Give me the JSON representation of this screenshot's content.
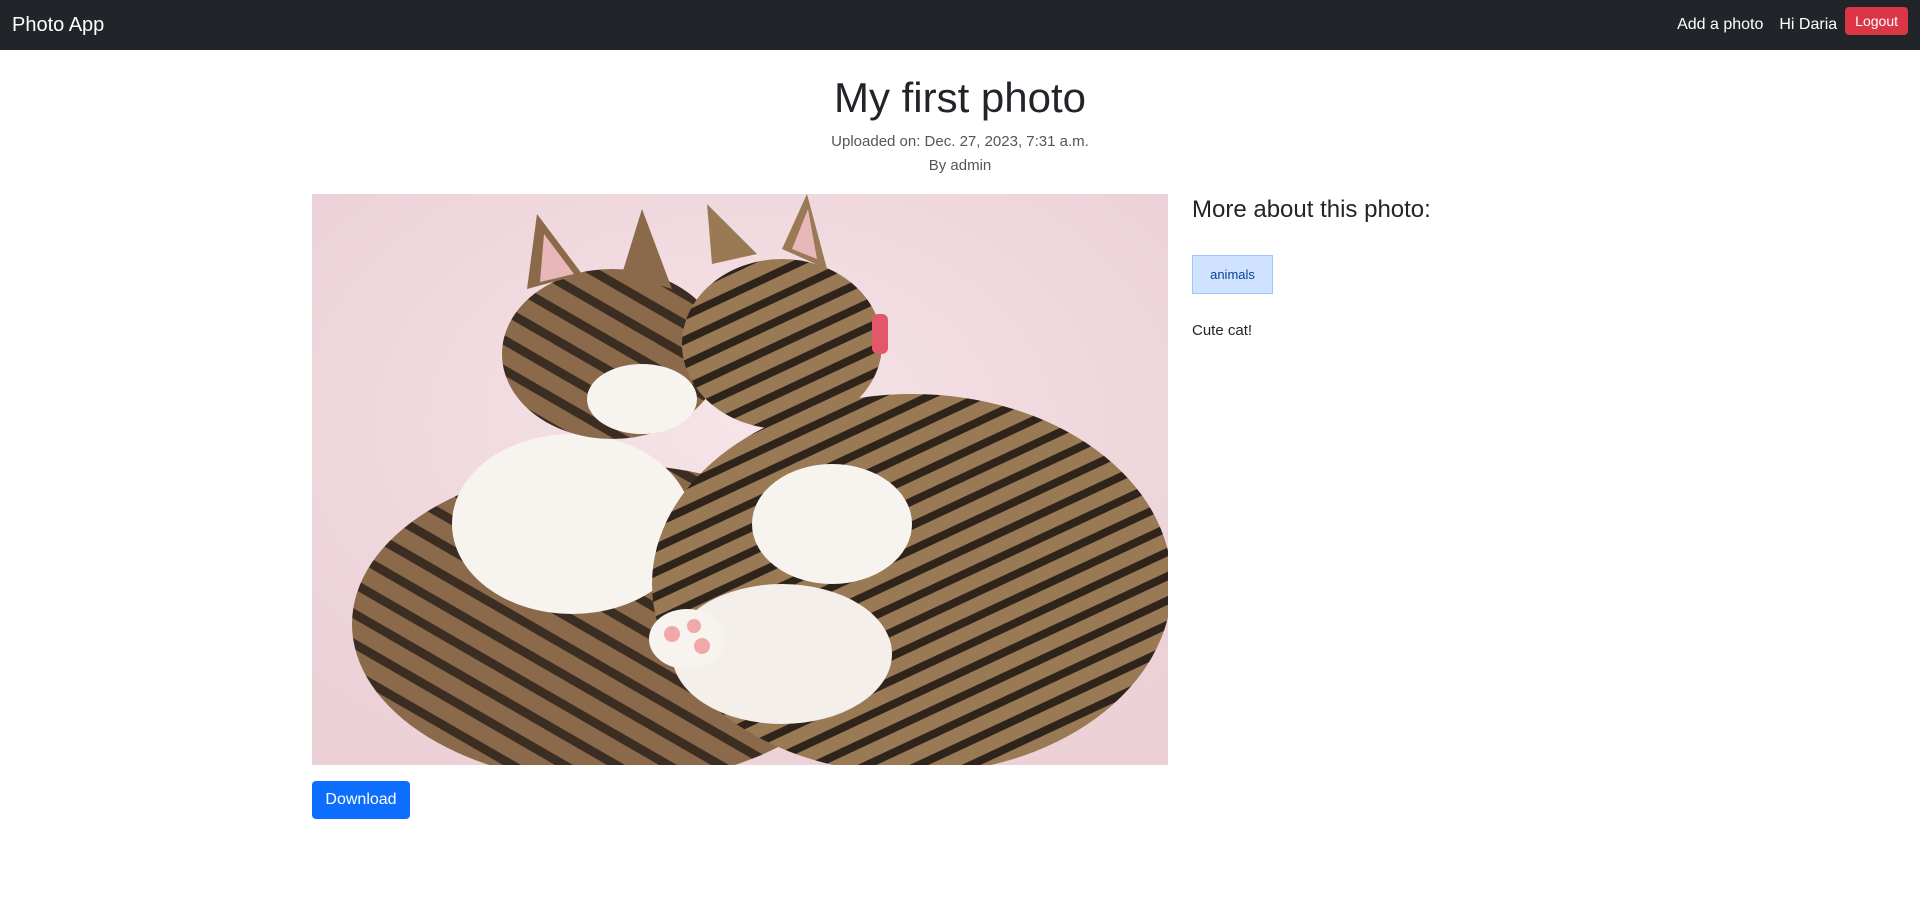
{
  "navbar": {
    "brand": "Photo App",
    "add_photo": "Add a photo",
    "greeting": "Hi Daria",
    "logout": "Logout"
  },
  "photo": {
    "title": "My first photo",
    "uploaded": "Uploaded on: Dec. 27, 2023, 7:31 a.m.",
    "author": "By admin",
    "alt": "Two tabby cats sleeping curled together on a pink blanket",
    "download_label": "Download"
  },
  "sidebar": {
    "heading": "More about this photo:",
    "tags": [
      "animals"
    ],
    "description": "Cute cat!"
  },
  "colors": {
    "navbar_bg": "#212529",
    "logout_bg": "#dc3545",
    "download_bg": "#0d6efd",
    "tag_bg": "#cfe2ff"
  }
}
